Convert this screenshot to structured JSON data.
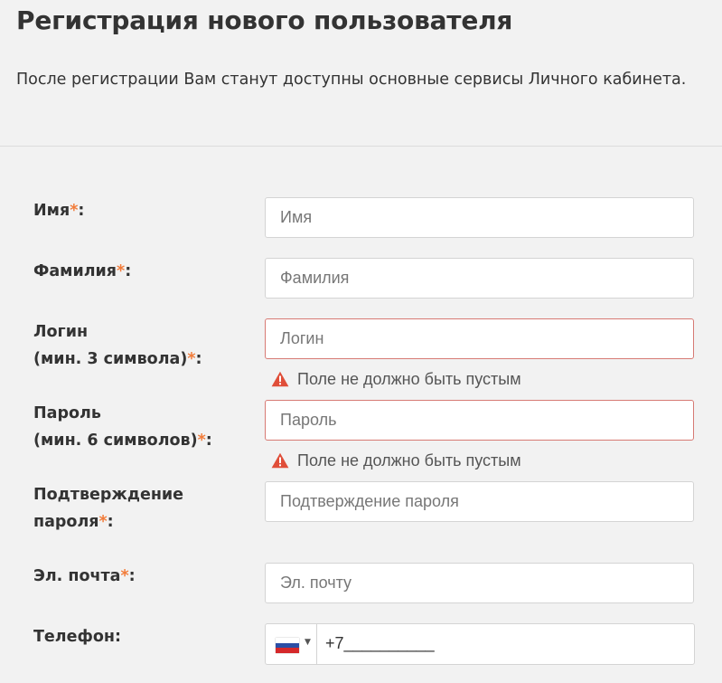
{
  "header": {
    "title": "Регистрация нового пользователя",
    "subtitle": "После регистрации Вам станут доступны основные сервисы Личного кабинета."
  },
  "form": {
    "required_mark": "*",
    "first_name": {
      "label": "Имя",
      "placeholder": "Имя",
      "value": ""
    },
    "last_name": {
      "label": "Фамилия",
      "placeholder": "Фамилия",
      "value": ""
    },
    "login": {
      "label_line1": "Логин",
      "label_line2": "(мин. 3 символа)",
      "placeholder": "Логин",
      "value": "",
      "error": "Поле не должно быть пустым"
    },
    "password": {
      "label_line1": "Пароль",
      "label_line2": "(мин. 6 символов)",
      "placeholder": "Пароль",
      "value": "",
      "error": "Поле не должно быть пустым"
    },
    "confirm_password": {
      "label_line1": "Подтверждение",
      "label_line2": "пароля",
      "placeholder": "Подтверждение пароля",
      "value": ""
    },
    "email": {
      "label": "Эл. почта",
      "placeholder": "Эл. почту",
      "value": ""
    },
    "phone": {
      "label": "Телефон:",
      "country_flag_icon": "russia-flag-icon",
      "value": "+7__________"
    }
  },
  "colors": {
    "required": "#f27c3a",
    "error_border": "#d77a74",
    "warning_icon": "#e04e39"
  }
}
